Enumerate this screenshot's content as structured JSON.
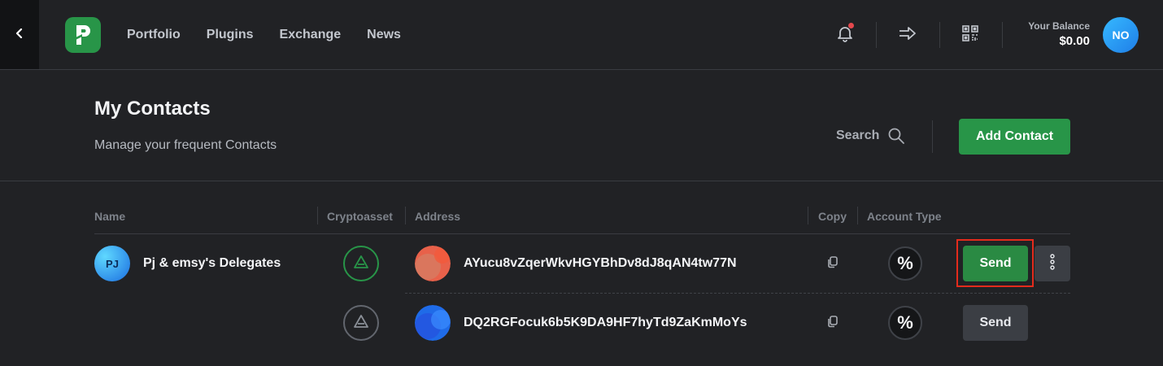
{
  "nav": {
    "items": [
      "Portfolio",
      "Plugins",
      "Exchange",
      "News"
    ],
    "balance_label": "Your Balance",
    "balance_value": "$0.00",
    "avatar_initials": "NO"
  },
  "header": {
    "title": "My Contacts",
    "subtitle": "Manage your frequent Contacts",
    "search_label": "Search",
    "add_contact_label": "Add Contact"
  },
  "table": {
    "columns": [
      "Name",
      "Cryptoasset",
      "Address",
      "Copy",
      "Account Type"
    ],
    "contact": {
      "initials": "PJ",
      "name": "Pj & emsy's Delegates"
    },
    "rows": [
      {
        "address": "AYucu8vZqerWkvHGYBhDv8dJ8qAN4tw77N",
        "account_type": "%",
        "send_label": "Send"
      },
      {
        "address": "DQ2RGFocuk6b5K9DA9HF7hyTd9ZaKmMoYs",
        "account_type": "%",
        "send_label": "Send"
      }
    ]
  },
  "colors": {
    "accent": "#289548",
    "background": "#212225",
    "highlight": "#e32b1c"
  }
}
